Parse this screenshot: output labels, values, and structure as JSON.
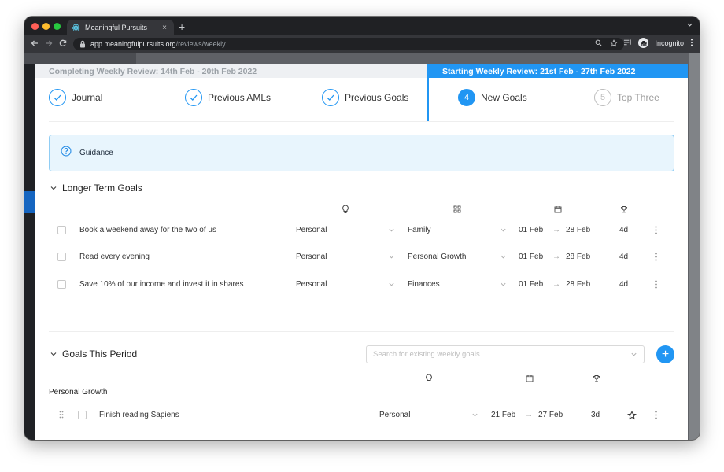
{
  "browser": {
    "tab_title": "Meaningful Pursuits",
    "tab_close": "×",
    "new_tab": "+",
    "url_host": "app.meaningfulpursuits.org",
    "url_path": "/reviews/weekly",
    "profile_label": "Incognito",
    "tab_favicon": "react-atom-icon"
  },
  "header": {
    "completing": "Completing Weekly Review: 14th Feb - 20th Feb 2022",
    "starting": "Starting Weekly Review: 21st Feb - 27th Feb 2022"
  },
  "stepper": {
    "steps": [
      {
        "label": "Journal",
        "state": "done"
      },
      {
        "label": "Previous AMLs",
        "state": "done"
      },
      {
        "label": "Previous Goals",
        "state": "done"
      },
      {
        "label": "New Goals",
        "state": "active",
        "number": "4"
      },
      {
        "label": "Top Three",
        "state": "inactive",
        "number": "5"
      }
    ]
  },
  "guidance": {
    "label": "Guidance"
  },
  "longer_term": {
    "title": "Longer Term Goals",
    "rows": [
      {
        "title": "Book a weekend away for the two of us",
        "category": "Personal",
        "area": "Family",
        "start": "01 Feb",
        "end": "28 Feb",
        "duration": "4d"
      },
      {
        "title": "Read every evening",
        "category": "Personal",
        "area": "Personal Growth",
        "start": "01 Feb",
        "end": "28 Feb",
        "duration": "4d"
      },
      {
        "title": "Save 10% of our income and invest it in shares",
        "category": "Personal",
        "area": "Finances",
        "start": "01 Feb",
        "end": "28 Feb",
        "duration": "4d"
      }
    ]
  },
  "goals_this_period": {
    "title": "Goals This Period",
    "search_placeholder": "Search for existing weekly goals",
    "add_label": "+",
    "group_label": "Personal Growth",
    "rows": [
      {
        "title": "Finish reading Sapiens",
        "category": "Personal",
        "start": "21 Feb",
        "end": "27 Feb",
        "duration": "3d"
      }
    ]
  },
  "colors": {
    "accent": "#2196f3",
    "guidance_bg": "#e8f5fd",
    "header_gray": "#eef0f3"
  }
}
